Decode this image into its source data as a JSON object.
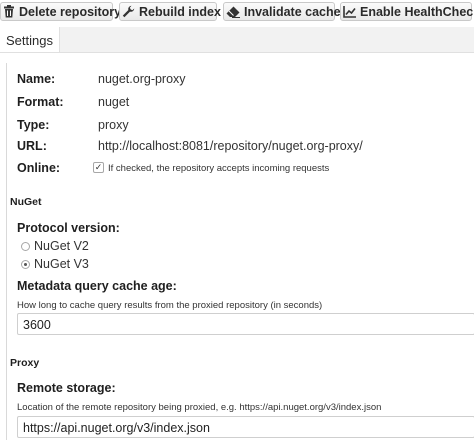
{
  "toolbar": {
    "delete_label": "Delete repository",
    "rebuild_label": "Rebuild index",
    "invalidate_label": "Invalidate cache",
    "healthcheck_label": "Enable HealthCheck",
    "icons": [
      "trash-icon",
      "wrench-icon",
      "eraser-icon",
      "chart-icon"
    ]
  },
  "tabs": [
    {
      "label": "Settings",
      "active": true
    }
  ],
  "repository": {
    "name_label": "Name:",
    "name_value": "nuget.org-proxy",
    "format_label": "Format:",
    "format_value": "nuget",
    "type_label": "Type:",
    "type_value": "proxy",
    "url_label": "URL:",
    "url_value": "http://localhost:8081/repository/nuget.org-proxy/",
    "online_label": "Online:",
    "online_checked": true,
    "online_help": "If checked, the repository accepts incoming requests"
  },
  "nuget": {
    "section_title": "NuGet",
    "protocol_label": "Protocol version:",
    "protocol_options": [
      {
        "label": "NuGet V2",
        "selected": false
      },
      {
        "label": "NuGet V3",
        "selected": true
      }
    ],
    "cache_age_label": "Metadata query cache age:",
    "cache_age_help": "How long to cache query results from the proxied repository (in seconds)",
    "cache_age_value": "3600"
  },
  "proxy": {
    "section_title": "Proxy",
    "remote_label": "Remote storage:",
    "remote_help": "Location of the remote repository being proxied, e.g. https://api.nuget.org/v3/index.json",
    "remote_value": "https://api.nuget.org/v3/index.json"
  },
  "colors": {
    "border": "#cfcfcf",
    "tab_bg": "#f2f2f2"
  }
}
